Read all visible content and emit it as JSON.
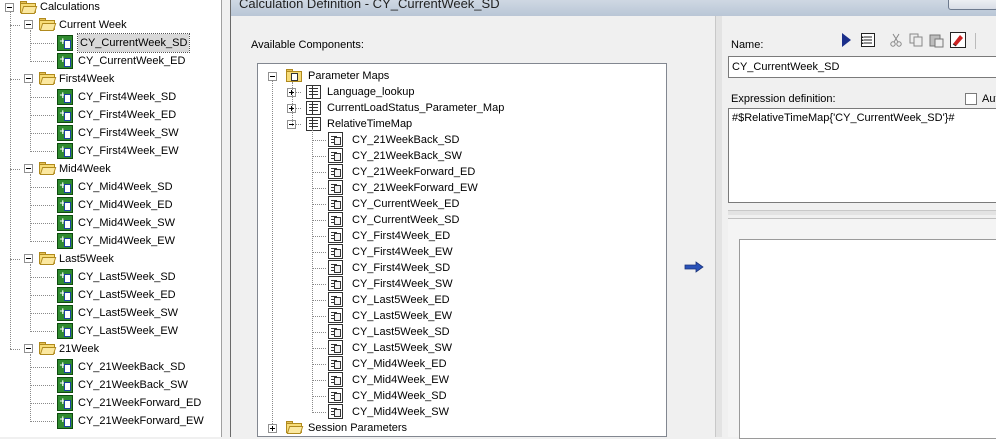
{
  "left_tree": {
    "root": "Calculations",
    "groups": [
      {
        "label": "Current Week",
        "items": [
          "CY_CurrentWeek_SD",
          "CY_CurrentWeek_ED"
        ]
      },
      {
        "label": "First4Week",
        "items": [
          "CY_First4Week_SD",
          "CY_First4Week_ED",
          "CY_First4Week_SW",
          "CY_First4Week_EW"
        ]
      },
      {
        "label": "Mid4Week",
        "items": [
          "CY_Mid4Week_SD",
          "CY_Mid4Week_ED",
          "CY_Mid4Week_SW",
          "CY_Mid4Week_EW"
        ]
      },
      {
        "label": "Last5Week",
        "items": [
          "CY_Last5Week_SD",
          "CY_Last5Week_ED",
          "CY_Last5Week_SW",
          "CY_Last5Week_EW"
        ]
      },
      {
        "label": "21Week",
        "items": [
          "CY_21WeekBack_SD",
          "CY_21WeekBack_SW",
          "CY_21WeekForward_ED",
          "CY_21WeekForward_EW"
        ]
      }
    ],
    "selected_item": "CY_CurrentWeek_SD"
  },
  "dialog": {
    "title": "Calculation Definition - CY_CurrentWeek_SD",
    "available_label": "Available Components:",
    "components_tree": {
      "parameter_maps_label": "Parameter Maps",
      "maps": [
        "Language_lookup",
        "CurrentLoadStatus_Parameter_Map",
        "RelativeTimeMap"
      ],
      "relative_time_entries": [
        "CY_21WeekBack_SD",
        "CY_21WeekBack_SW",
        "CY_21WeekForward_ED",
        "CY_21WeekForward_EW",
        "CY_CurrentWeek_ED",
        "CY_CurrentWeek_SD",
        "CY_First4Week_ED",
        "CY_First4Week_EW",
        "CY_First4Week_SD",
        "CY_First4Week_SW",
        "CY_Last5Week_ED",
        "CY_Last5Week_EW",
        "CY_Last5Week_SD",
        "CY_Last5Week_SW",
        "CY_Mid4Week_ED",
        "CY_Mid4Week_EW",
        "CY_Mid4Week_SD",
        "CY_Mid4Week_SW"
      ],
      "session_parameters_label": "Session Parameters"
    },
    "name_label": "Name:",
    "name_value": "CY_CurrentWeek_SD",
    "expression_label": "Expression definition:",
    "auto_label": "Aut",
    "expression_value": "#$RelativeTimeMap{'CY_CurrentWeek_SD'}#",
    "toolbar_icons": [
      "run-icon",
      "properties-icon",
      "cut-icon",
      "copy-icon",
      "paste-icon",
      "clear-icon"
    ]
  }
}
